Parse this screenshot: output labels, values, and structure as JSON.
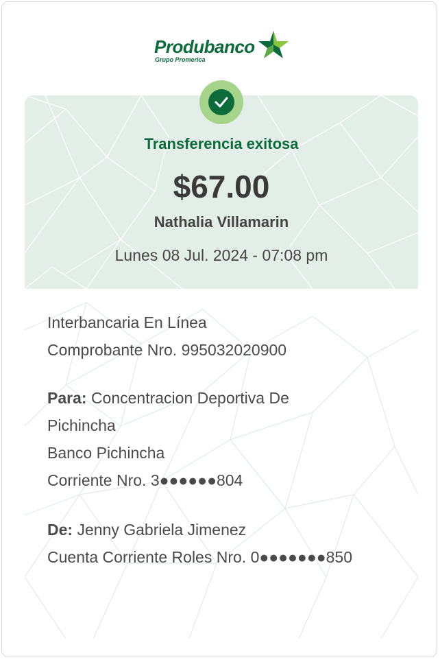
{
  "brand": {
    "name": "Produbanco",
    "subtitle": "Grupo Promerica",
    "color": "#0a6a3a",
    "accent": "#8cc63f"
  },
  "receipt": {
    "status": "Transferencia exitosa",
    "amount": "$67.00",
    "recipient_name": "Nathalia Villamarin",
    "datetime": "Lunes 08 Jul. 2024 - 07:08 pm",
    "transfer_type": "Interbancaria En Línea",
    "voucher": "Comprobante Nro. 995032020900",
    "to": {
      "label": "Para:",
      "name_line1": "Concentracion Deportiva De",
      "name_line2": "Pichincha",
      "bank": "Banco Pichincha",
      "account": "Corriente Nro. 3●●●●●●804"
    },
    "from": {
      "label": "De:",
      "name": "Jenny Gabriela Jimenez",
      "account": "Cuenta Corriente Roles Nro. 0●●●●●●●850"
    }
  },
  "icons": {
    "logo_star": "star-logo-icon",
    "success": "check-circle-icon"
  },
  "colors": {
    "header_bg": "#e3eee8",
    "success_badge": "#a6d48a",
    "success_check_bg": "#0b6b3b",
    "status_text": "#0d6b3b"
  }
}
